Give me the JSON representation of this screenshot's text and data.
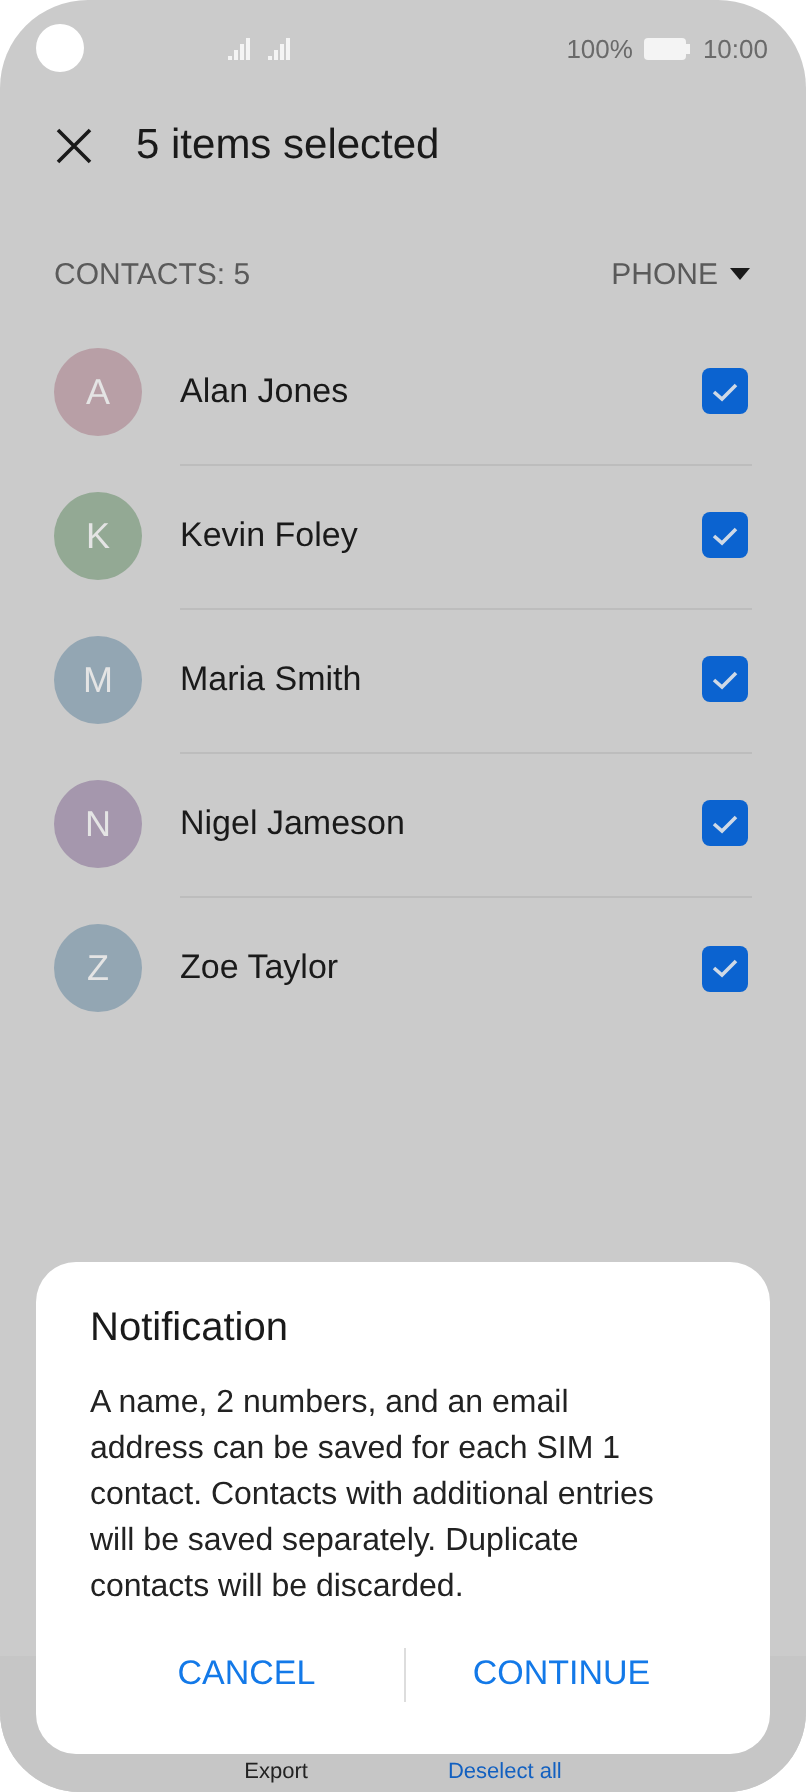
{
  "status_bar": {
    "battery_text": "100%",
    "time": "10:00"
  },
  "header": {
    "title": "5 items selected"
  },
  "list_header": {
    "count_label": "CONTACTS: 5",
    "filter_label": "PHONE"
  },
  "contacts": [
    {
      "initial": "A",
      "name": "Alan Jones",
      "color": "#b89fa6",
      "checked": true
    },
    {
      "initial": "K",
      "name": "Kevin Foley",
      "color": "#93a994",
      "checked": true
    },
    {
      "initial": "M",
      "name": "Maria Smith",
      "color": "#93a6b3",
      "checked": true
    },
    {
      "initial": "N",
      "name": "Nigel Jameson",
      "color": "#a597ad",
      "checked": true
    },
    {
      "initial": "Z",
      "name": "Zoe Taylor",
      "color": "#93a6b3",
      "checked": true
    }
  ],
  "bottom_bar": [
    {
      "label": "Export",
      "kind": "plain"
    },
    {
      "label": "Deselect all",
      "kind": "accent"
    }
  ],
  "dialog": {
    "title": "Notification",
    "message": "A name, 2 numbers, and an email address can be saved for each SIM 1 contact. Contacts with additional entries will be saved separately. Duplicate contacts will be discarded.",
    "buttons": [
      "CANCEL",
      "CONTINUE"
    ]
  }
}
